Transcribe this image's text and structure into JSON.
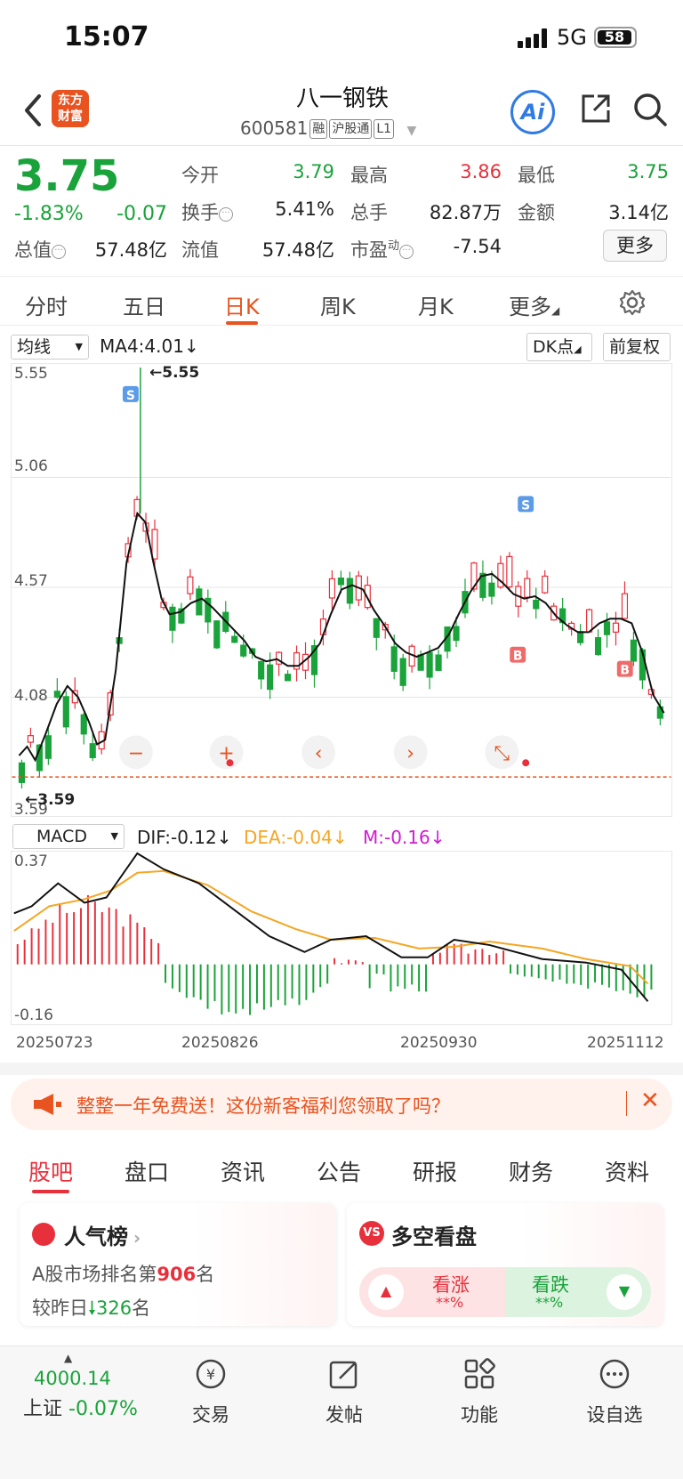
{
  "status": {
    "time": "15:07",
    "network": "5G",
    "battery": "58"
  },
  "header": {
    "logo_line1": "东方",
    "logo_line2": "财富",
    "name": "八一钢铁",
    "code": "600581",
    "tags": [
      "融",
      "沪股通",
      "L1"
    ],
    "ai_label": "Ai"
  },
  "quote": {
    "price": "3.75",
    "change_pct": "-1.83%",
    "change_val": "-0.07",
    "open_label": "今开",
    "open": "3.79",
    "high_label": "最高",
    "high": "3.86",
    "low_label": "最低",
    "low": "3.75",
    "turnover_label": "换手",
    "turnover": "5.41%",
    "volume_label": "总手",
    "volume": "82.87万",
    "amount_label": "金额",
    "amount": "3.14亿",
    "mcap_label": "总值",
    "mcap": "57.48亿",
    "float_label": "流值",
    "float": "57.48亿",
    "pe_label": "市盈",
    "pe_sup": "动",
    "pe": "-7.54",
    "more": "更多"
  },
  "period_tabs": [
    "分时",
    "五日",
    "日K",
    "周K",
    "月K",
    "更多"
  ],
  "chart_toolbar": {
    "indicator": "均线",
    "ma": "MA4:4.01",
    "dk": "DK点",
    "adjust": "前复权"
  },
  "chart_data": [
    {
      "type": "candlestick",
      "y_ticks": [
        "5.55",
        "5.06",
        "4.57",
        "4.08",
        "3.59"
      ],
      "ylim": [
        3.59,
        5.55
      ],
      "annotations": {
        "max": "5.55",
        "min": "3.59",
        "signals": [
          "S",
          "S",
          "B",
          "B"
        ]
      },
      "series": [
        {
          "name": "MA4",
          "line": [
            [
              0,
              3.82
            ],
            [
              3,
              3.86
            ],
            [
              6,
              3.8
            ],
            [
              10,
              3.92
            ],
            [
              14,
              4.05
            ],
            [
              18,
              4.13
            ],
            [
              22,
              4.08
            ],
            [
              26,
              3.97
            ],
            [
              29,
              3.87
            ],
            [
              32,
              3.89
            ],
            [
              36,
              4.2
            ],
            [
              40,
              4.68
            ],
            [
              44,
              4.9
            ],
            [
              47,
              4.86
            ],
            [
              50,
              4.68
            ],
            [
              53,
              4.52
            ],
            [
              56,
              4.45
            ],
            [
              60,
              4.46
            ],
            [
              64,
              4.5
            ],
            [
              68,
              4.52
            ],
            [
              72,
              4.48
            ],
            [
              76,
              4.43
            ],
            [
              80,
              4.38
            ],
            [
              84,
              4.33
            ],
            [
              88,
              4.26
            ],
            [
              92,
              4.24
            ],
            [
              96,
              4.25
            ],
            [
              100,
              4.22
            ],
            [
              104,
              4.22
            ],
            [
              108,
              4.26
            ],
            [
              112,
              4.32
            ],
            [
              116,
              4.45
            ],
            [
              120,
              4.56
            ],
            [
              124,
              4.58
            ],
            [
              128,
              4.56
            ],
            [
              132,
              4.47
            ],
            [
              136,
              4.4
            ],
            [
              140,
              4.32
            ],
            [
              144,
              4.28
            ],
            [
              148,
              4.26
            ],
            [
              152,
              4.28
            ],
            [
              156,
              4.3
            ],
            [
              160,
              4.36
            ],
            [
              164,
              4.46
            ],
            [
              168,
              4.55
            ],
            [
              172,
              4.62
            ],
            [
              176,
              4.63
            ],
            [
              180,
              4.59
            ],
            [
              184,
              4.54
            ],
            [
              188,
              4.52
            ],
            [
              192,
              4.53
            ],
            [
              196,
              4.5
            ],
            [
              200,
              4.44
            ],
            [
              204,
              4.4
            ],
            [
              208,
              4.37
            ],
            [
              212,
              4.37
            ],
            [
              216,
              4.41
            ],
            [
              220,
              4.43
            ],
            [
              224,
              4.43
            ],
            [
              228,
              4.41
            ],
            [
              232,
              4.28
            ],
            [
              236,
              4.09
            ],
            [
              240,
              4.01
            ]
          ]
        }
      ]
    },
    {
      "type": "line",
      "title": "MACD",
      "y_ticks": [
        "0.37",
        "-0.16"
      ],
      "x_ticks": [
        "20250723",
        "20250826",
        "20250930",
        "20251112"
      ],
      "legend": {
        "dif": "DIF:-0.12",
        "dea": "DEA:-0.04",
        "m": "M:-0.16"
      },
      "series": [
        {
          "name": "DIF",
          "color": "#222222"
        },
        {
          "name": "DEA",
          "color": "#f5a623"
        },
        {
          "name": "M",
          "color": "#d01cd0"
        }
      ]
    }
  ],
  "promo": {
    "text": "整整一年免费送！这份新客福利您领取了吗？"
  },
  "lower_tabs": [
    "股吧",
    "盘口",
    "资讯",
    "公告",
    "研报",
    "财务",
    "资料"
  ],
  "popularity": {
    "title": "人气榜",
    "rank_prefix": "A股市场排名第",
    "rank": "906",
    "rank_suffix": "名",
    "vs_prefix": "较昨日",
    "vs": "326",
    "vs_suffix": "名"
  },
  "sentiment": {
    "title": "多空看盘",
    "bull": "看涨",
    "bull_val": "**%",
    "bear": "看跌",
    "bear_val": "**%"
  },
  "bottom_nav": {
    "index_value": "4000.14",
    "index_name": "上证",
    "index_change": "-0.07%",
    "items": [
      "交易",
      "发帖",
      "功能",
      "设自选"
    ]
  }
}
